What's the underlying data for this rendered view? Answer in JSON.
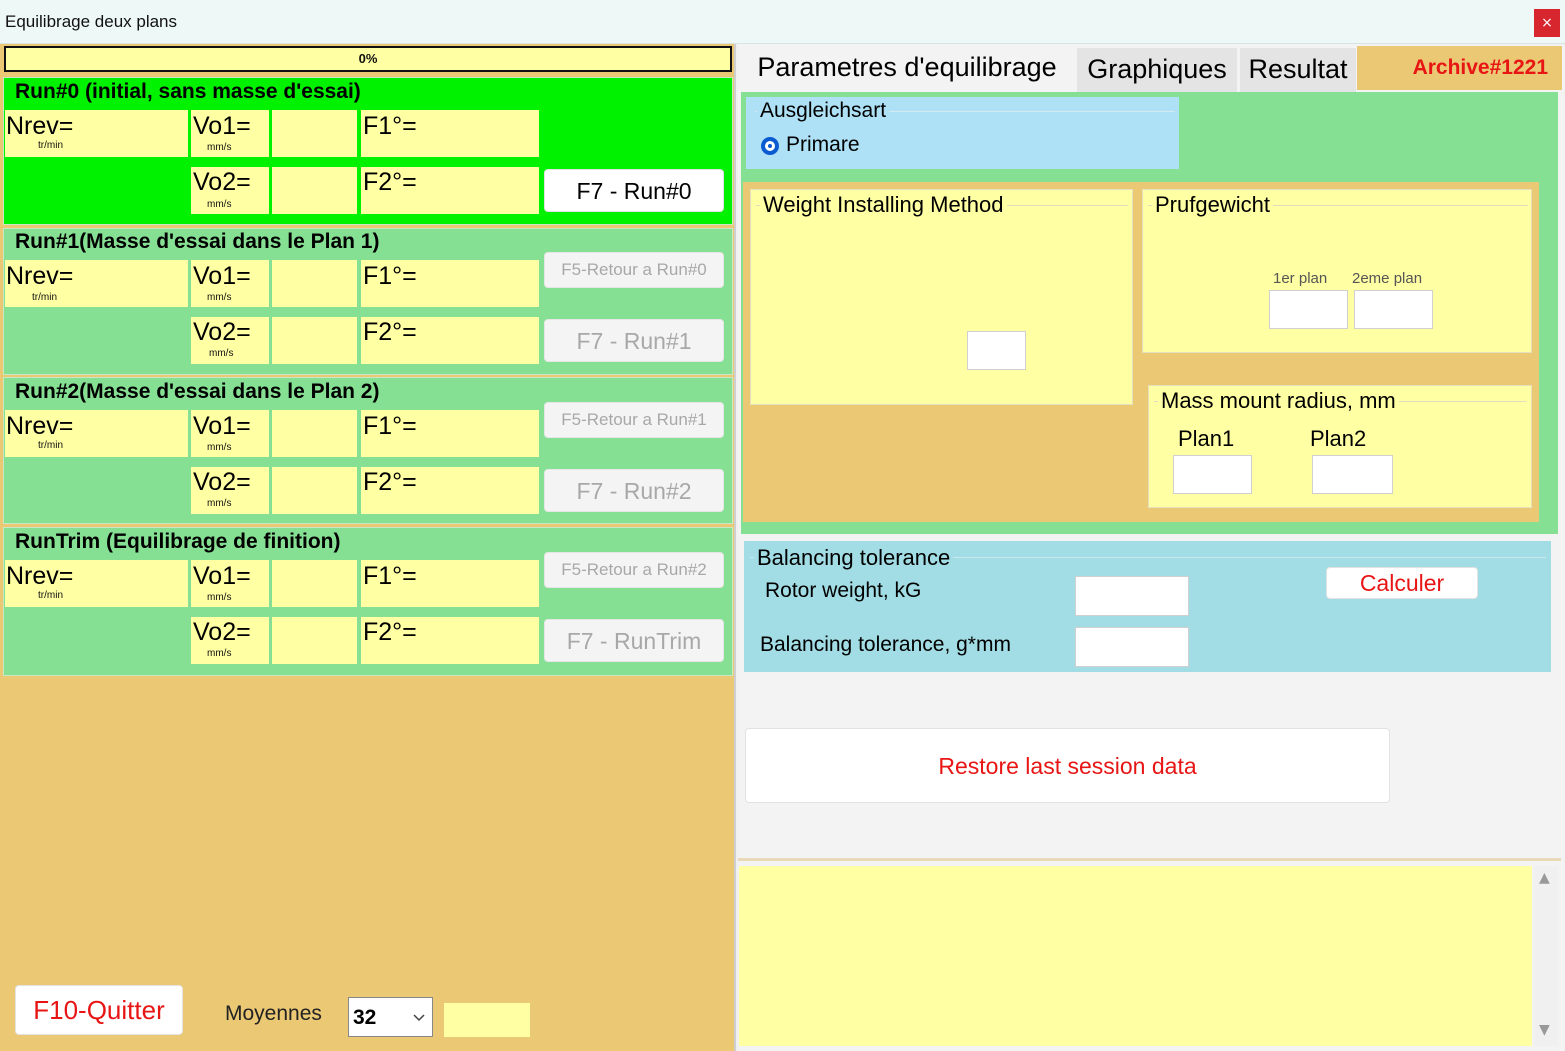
{
  "window": {
    "title": "Equilibrage deux plans",
    "close_glyph": "×"
  },
  "progress": {
    "text": "0%",
    "value": 0
  },
  "runs": [
    {
      "title": "Run#0 (initial, sans masse d'essai)",
      "nrev": "Nrev=",
      "nrev_unit": "tr/min",
      "vo1": "Vo1=",
      "vo1_unit": "mm/s",
      "vo2": "Vo2=",
      "vo2_unit": "mm/s",
      "f1": "F1°=",
      "f2": "F2°=",
      "btn_top": "",
      "btn_run": "F7 - Run#0"
    },
    {
      "title": "Run#1(Masse d'essai dans le Plan 1)",
      "nrev": "Nrev=",
      "nrev_unit": "tr/min",
      "vo1": "Vo1=",
      "vo1_unit": "mm/s",
      "vo2": "Vo2=",
      "vo2_unit": "mm/s",
      "f1": "F1°=",
      "f2": "F2°=",
      "btn_top": "F5-Retour a Run#0",
      "btn_run": "F7 - Run#1"
    },
    {
      "title": "Run#2(Masse d'essai dans le Plan 2)",
      "nrev": "Nrev=",
      "nrev_unit": "tr/min",
      "vo1": "Vo1=",
      "vo1_unit": "mm/s",
      "vo2": "Vo2=",
      "vo2_unit": "mm/s",
      "f1": "F1°=",
      "f2": "F2°=",
      "btn_top": "F5-Retour a Run#1",
      "btn_run": "F7 - Run#2"
    },
    {
      "title": "RunTrim (Equilibrage de finition)",
      "nrev": "Nrev=",
      "nrev_unit": "tr/min",
      "vo1": "Vo1=",
      "vo1_unit": "mm/s",
      "vo2": "Vo2=",
      "vo2_unit": "mm/s",
      "f1": "F1°=",
      "f2": "F2°=",
      "btn_top": "F5-Retour a Run#2",
      "btn_run": "F7 - RunTrim"
    }
  ],
  "footer": {
    "quit": "F10-Quitter",
    "moyennes_label": "Moyennes",
    "moyennes_value": "32"
  },
  "tabs": [
    {
      "label": "Parametres d'equilibrage",
      "active": true
    },
    {
      "label": "Graphiques",
      "active": false
    },
    {
      "label": "Resultat",
      "active": false
    }
  ],
  "archive": "Archive#1221",
  "ausgleichsart": {
    "legend": "Ausgleichsart",
    "option": "Primare",
    "selected": true
  },
  "weight_method": {
    "legend": "Weight Installing Method"
  },
  "prufgewicht": {
    "legend": "Prufgewicht",
    "plan1": "1er plan",
    "plan2": "2eme plan"
  },
  "mass_radius": {
    "legend": "Mass mount radius, mm",
    "plan1": "Plan1",
    "plan2": "Plan2"
  },
  "tolerance": {
    "legend": "Balancing tolerance",
    "rotor_weight": "Rotor weight, kG",
    "tolerance_label": "Balancing tolerance, g*mm",
    "calc": "Calculer"
  },
  "restore": "Restore last session data",
  "log": {
    "up": "▲",
    "down": "▼"
  },
  "colors": {
    "green_active": "#00f200",
    "green": "#86e093",
    "yellow": "#ffffa3",
    "tan": "#ebc874",
    "blue": "#aee0f6",
    "teal": "#a2dce4",
    "red": "#e81515"
  }
}
